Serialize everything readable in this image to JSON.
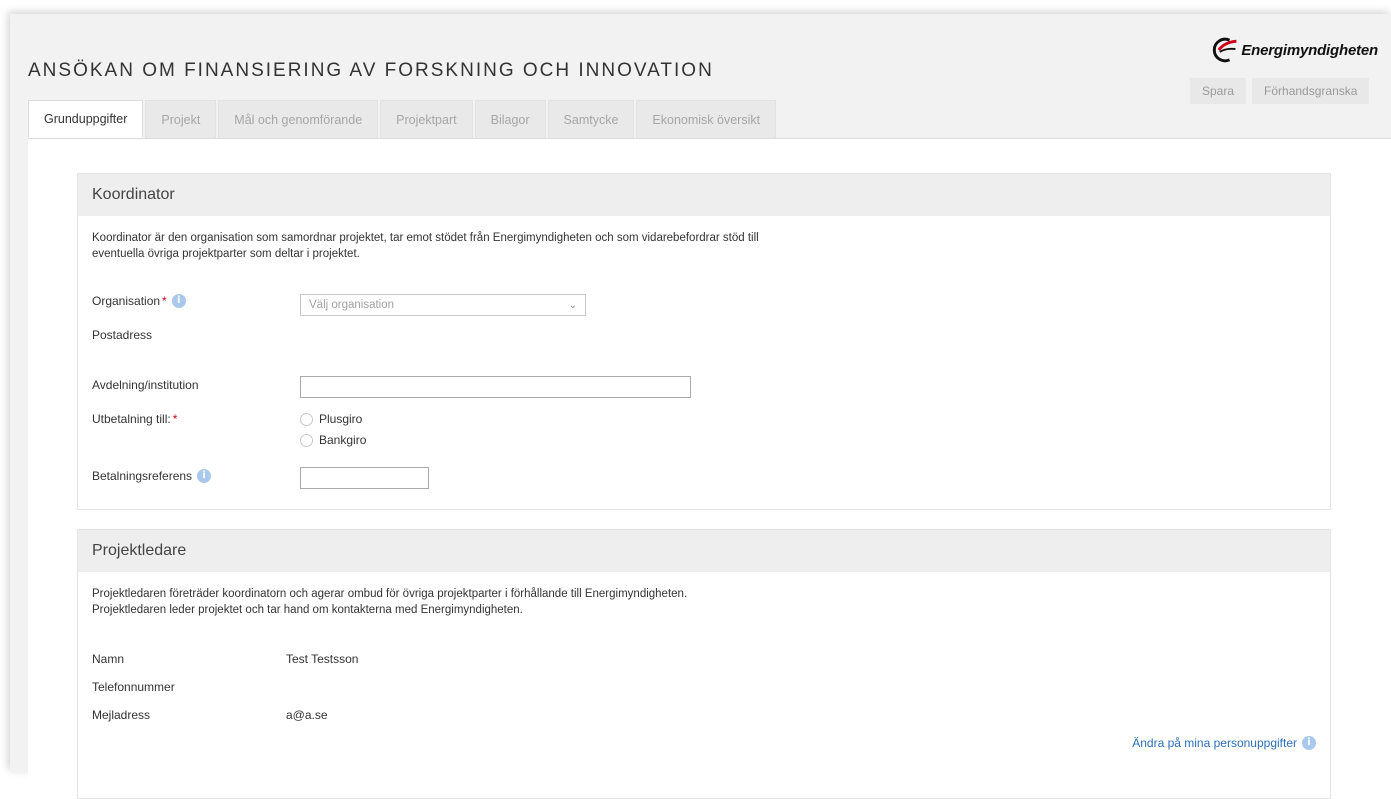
{
  "header": {
    "title": "ANSÖKAN OM FINANSIERING AV FORSKNING OCH INNOVATION",
    "logo_text": "Energimyndigheten",
    "actions": {
      "save": "Spara",
      "preview": "Förhandsgranska"
    }
  },
  "tabs": [
    {
      "label": "Grunduppgifter",
      "active": true
    },
    {
      "label": "Projekt"
    },
    {
      "label": "Mål och genomförande"
    },
    {
      "label": "Projektpart"
    },
    {
      "label": "Bilagor"
    },
    {
      "label": "Samtycke"
    },
    {
      "label": "Ekonomisk översikt"
    }
  ],
  "koordinator": {
    "heading": "Koordinator",
    "description_line1": "Koordinator är den organisation som samordnar projektet, tar emot stödet från Energimyndigheten och som vidarebefordrar stöd till",
    "description_line2": "eventuella övriga projektparter som deltar i projektet.",
    "organisation_label": "Organisation",
    "organisation_placeholder": "Välj organisation",
    "postadress_label": "Postadress",
    "avdelning_label": "Avdelning/institution",
    "avdelning_value": "",
    "utbetalning_label": "Utbetalning till:",
    "options": [
      "Plusgiro",
      "Bankgiro"
    ],
    "betalningsreferens_label": "Betalningsreferens",
    "betalningsreferens_value": "",
    "required_mark": "*"
  },
  "projektledare": {
    "heading": "Projektledare",
    "description_line1": "Projektledaren företräder koordinatorn och agerar ombud för övriga projektparter i förhållande till Energimyndigheten.",
    "description_line2": "Projektledaren leder projektet och tar hand om kontakterna med Energimyndigheten.",
    "namn_label": "Namn",
    "namn_value": "Test Testsson",
    "telefon_label": "Telefonnummer",
    "telefon_value": "",
    "mejl_label": "Mejladress",
    "mejl_value": "a@a.se",
    "edit_link": "Ändra på mina personuppgifter"
  },
  "icons": {
    "info": "info-icon",
    "chevron": "chevron-down-icon",
    "logo": "energimyndigheten-logo-icon"
  },
  "colors": {
    "required": "#d0021b",
    "link": "#2a6ebb",
    "info": "#a9c8ec"
  }
}
